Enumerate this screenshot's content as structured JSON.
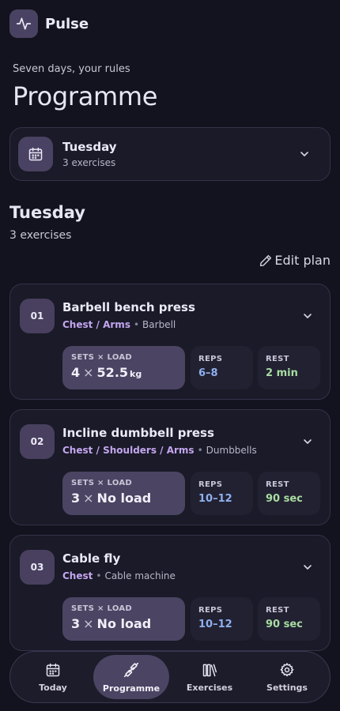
{
  "app": {
    "title": "Pulse",
    "logo_icon": "pulse-icon"
  },
  "page": {
    "subtitle": "Seven days, your rules",
    "title": "Programme"
  },
  "day_selector": {
    "day": "Tuesday",
    "count": "3 exercises",
    "icon": "calendar-icon"
  },
  "section": {
    "title": "Tuesday",
    "count": "3 exercises",
    "edit_label": "Edit plan"
  },
  "exercises": [
    {
      "number": "01",
      "name": "Barbell bench press",
      "muscles": "Chest / Arms",
      "equipment": "Barbell",
      "sets_load_label": "SETS × LOAD",
      "sets": "4",
      "times": "×",
      "load": "52.5",
      "load_unit": "kg",
      "reps_label": "REPS",
      "reps": "6–8",
      "rest_label": "REST",
      "rest": "2 min"
    },
    {
      "number": "02",
      "name": "Incline dumbbell press",
      "muscles": "Chest / Shoulders / Arms",
      "equipment": "Dumbbells",
      "sets_load_label": "SETS × LOAD",
      "sets": "3",
      "times": "×",
      "load": "No load",
      "load_unit": "",
      "reps_label": "REPS",
      "reps": "10–12",
      "rest_label": "REST",
      "rest": "90 sec"
    },
    {
      "number": "03",
      "name": "Cable fly",
      "muscles": "Chest",
      "equipment": "Cable machine",
      "sets_load_label": "SETS × LOAD",
      "sets": "3",
      "times": "×",
      "load": "No load",
      "load_unit": "",
      "reps_label": "REPS",
      "reps": "10–12",
      "rest_label": "REST",
      "rest": "90 sec"
    }
  ],
  "nav": {
    "items": [
      {
        "label": "Today",
        "icon": "calendar-icon"
      },
      {
        "label": "Programme",
        "icon": "dumbbell-icon",
        "active": true
      },
      {
        "label": "Exercises",
        "icon": "library-icon"
      },
      {
        "label": "Settings",
        "icon": "gear-icon"
      }
    ]
  },
  "colors": {
    "background": "#13131f",
    "accent": "#4b4462",
    "muscles": "#c3a6ee",
    "reps": "#8fb0ee",
    "rest": "#a8dca0"
  }
}
